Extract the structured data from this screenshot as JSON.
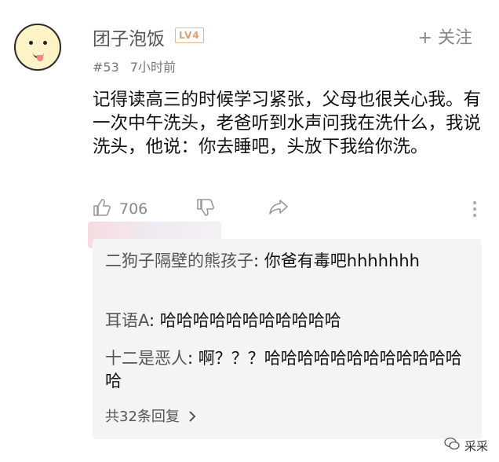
{
  "comment": {
    "username": "团子泡饭",
    "level_badge": "LV4",
    "follow_label": "+ 关注",
    "floor": "#53",
    "time": "7小时前",
    "text": "记得读高三的时候学习紧张，父母也很关心我。有一次中午洗头，老爸听到水声问我在洗什么，我说洗头，他说：你去睡吧，头放下我给你洗。",
    "likes": "706"
  },
  "replies": [
    {
      "name": "二狗子隔壁的熊孩子",
      "text": "你爸有毒吧hhhhhhh"
    },
    {
      "name": "耳语A",
      "text": "哈哈哈哈哈哈哈哈哈哈哈"
    },
    {
      "name": "十二是恶人",
      "text": "啊？？？哈哈哈哈哈哈哈哈哈哈哈哈哈"
    }
  ],
  "more_replies": "共32条回复",
  "watermark": "采采",
  "icons": [
    "avatar",
    "like-icon",
    "dislike-icon",
    "share-icon",
    "more-icon",
    "chevron-right-icon",
    "wechat-icon"
  ]
}
